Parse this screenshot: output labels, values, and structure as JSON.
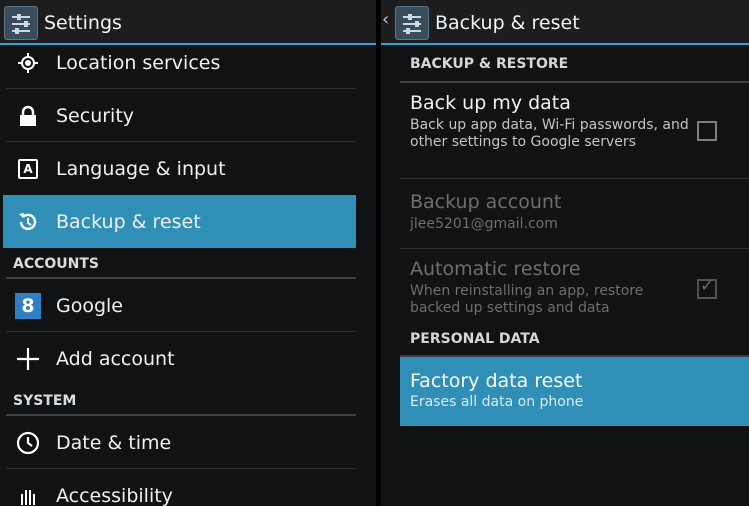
{
  "left": {
    "title": "Settings",
    "items_top": [
      {
        "label": "Location services",
        "icon": "location-icon"
      },
      {
        "label": "Security",
        "icon": "lock-icon"
      },
      {
        "label": "Language & input",
        "icon": "keyboard-icon",
        "glyph": "A"
      },
      {
        "label": "Backup & reset",
        "icon": "backup-icon",
        "selected": true
      }
    ],
    "accounts_header": "ACCOUNTS",
    "accounts": [
      {
        "label": "Google",
        "icon": "google-icon",
        "glyph": "8"
      },
      {
        "label": "Add account",
        "icon": "plus-icon"
      }
    ],
    "system_header": "SYSTEM",
    "system": [
      {
        "label": "Date & time",
        "icon": "clock-icon"
      },
      {
        "label": "Accessibility",
        "icon": "hand-icon"
      }
    ]
  },
  "right": {
    "title": "Backup & reset",
    "backup_header": "BACKUP & RESTORE",
    "backup_my_data": {
      "title": "Back up my data",
      "summary": "Back up app data, Wi-Fi passwords, and other settings to Google servers",
      "checked": false
    },
    "backup_account": {
      "title": "Backup account",
      "summary": "jlee5201@gmail.com"
    },
    "automatic_restore": {
      "title": "Automatic restore",
      "summary": "When reinstalling an app, restore backed up settings and data",
      "checked": true
    },
    "personal_header": "PERSONAL DATA",
    "factory_reset": {
      "title": "Factory data reset",
      "summary": "Erases all data on phone"
    }
  },
  "colors": {
    "accent": "#39a4d6",
    "selected": "#2f8fb6",
    "background": "#101214"
  }
}
